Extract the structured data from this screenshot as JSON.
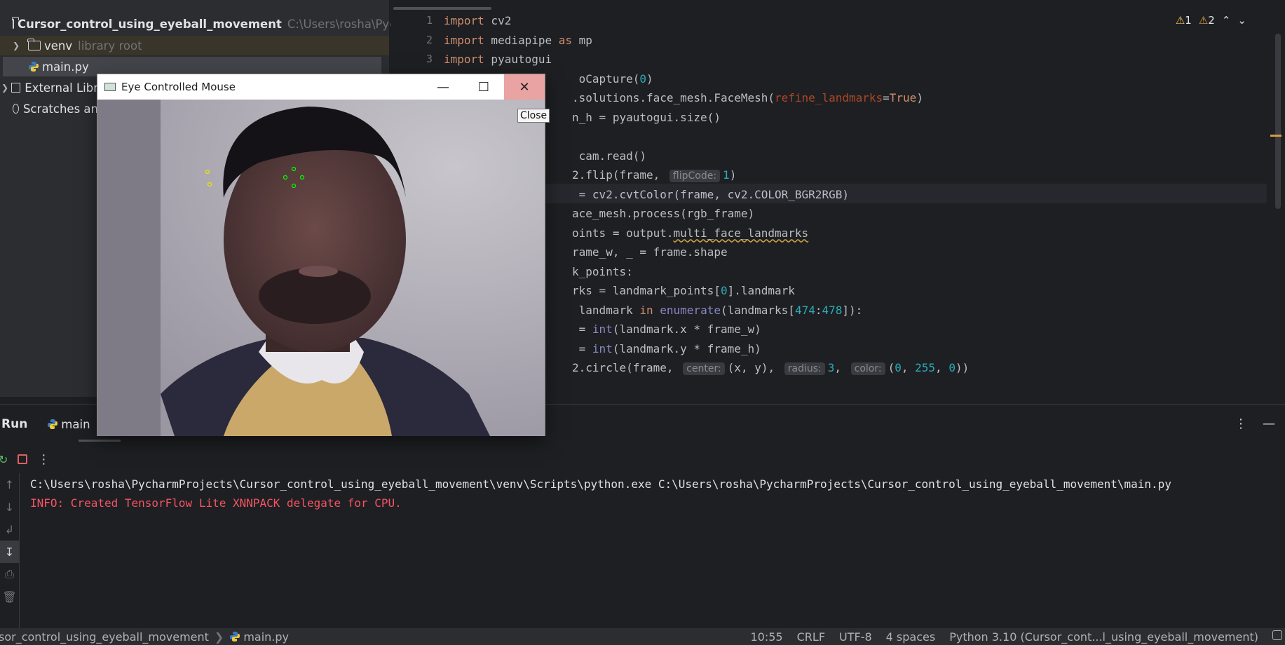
{
  "project": {
    "root_name": "Cursor_control_using_eyeball_movement",
    "root_path": "C:\\Users\\rosha\\Pych",
    "venv": "venv",
    "venv_note": "library root",
    "main_file": "main.py",
    "external": "External Libr",
    "scratches": "Scratches an"
  },
  "editor": {
    "line_numbers": [
      "1",
      "2",
      "3"
    ],
    "inspections": {
      "warnings_yellow": "1",
      "warnings_orange": "2"
    },
    "lines": [
      [
        {
          "t": "import",
          "c": "kw"
        },
        {
          "t": " cv2"
        }
      ],
      [
        {
          "t": "import",
          "c": "kw"
        },
        {
          "t": " mediapipe "
        },
        {
          "t": "as",
          "c": "kw"
        },
        {
          "t": " mp"
        }
      ],
      [
        {
          "t": "import",
          "c": "kw"
        },
        {
          "t": " pyautogui"
        }
      ],
      [
        {
          "t": "                    oCapture("
        },
        {
          "t": "0",
          "c": "num"
        },
        {
          "t": ")"
        }
      ],
      [
        {
          "t": "                   .solutions.face_mesh.FaceMesh("
        },
        {
          "t": "refine_landmarks",
          "c": "named"
        },
        {
          "t": "="
        },
        {
          "t": "True",
          "c": "kw"
        },
        {
          "t": ")"
        }
      ],
      [
        {
          "t": "                   n_h = pyautogui.size()"
        }
      ],
      [
        {
          "t": ""
        }
      ],
      [
        {
          "t": "                    cam.read()"
        }
      ],
      [
        {
          "t": "                   2.flip(frame, "
        },
        {
          "h": "flipCode:"
        },
        {
          "t": "1",
          "c": "num"
        },
        {
          "t": ")"
        }
      ],
      [
        {
          "t": "                    = cv2.cvtColor(frame, cv2.COLOR_BGR2RGB)"
        }
      ],
      [
        {
          "t": "                   ace_mesh.process(rgb_frame)"
        }
      ],
      [
        {
          "t": "                   oints = output."
        },
        {
          "t": "multi_face_landmarks",
          "c": "underline"
        }
      ],
      [
        {
          "t": "                   rame_w, _ = frame.shape"
        }
      ],
      [
        {
          "t": "                   k_points:"
        }
      ],
      [
        {
          "t": "                   rks = landmark_points["
        },
        {
          "t": "0",
          "c": "num"
        },
        {
          "t": "].landmark"
        }
      ],
      [
        {
          "t": "                    landmark "
        },
        {
          "t": "in",
          "c": "kw"
        },
        {
          "t": " "
        },
        {
          "t": "enumerate",
          "c": "builtin"
        },
        {
          "t": "(landmarks["
        },
        {
          "t": "474",
          "c": "num"
        },
        {
          "t": ":"
        },
        {
          "t": "478",
          "c": "num"
        },
        {
          "t": "]):"
        }
      ],
      [
        {
          "t": "                    = "
        },
        {
          "t": "int",
          "c": "builtin"
        },
        {
          "t": "(landmark.x * frame_w)"
        }
      ],
      [
        {
          "t": "                    = "
        },
        {
          "t": "int",
          "c": "builtin"
        },
        {
          "t": "(landmark.y * frame_h)"
        }
      ],
      [
        {
          "t": "                   2.circle(frame, "
        },
        {
          "h": "center:"
        },
        {
          "t": "(x, y), "
        },
        {
          "h": "radius:"
        },
        {
          "t": "3",
          "c": "num"
        },
        {
          "t": ", "
        },
        {
          "h": "color:"
        },
        {
          "t": "("
        },
        {
          "t": "0",
          "c": "num"
        },
        {
          "t": ", "
        },
        {
          "t": "255",
          "c": "num"
        },
        {
          "t": ", "
        },
        {
          "t": "0",
          "c": "num"
        },
        {
          "t": "))"
        }
      ]
    ]
  },
  "cv_window": {
    "title": "Eye Controlled Mouse",
    "tooltip": "Close",
    "markers_yellow": [
      [
        295,
        244
      ],
      [
        298,
        262
      ]
    ],
    "markers_green": [
      [
        418,
        240
      ],
      [
        406,
        252
      ],
      [
        430,
        252
      ],
      [
        418,
        264
      ]
    ]
  },
  "run": {
    "title": "Run",
    "tab": "main",
    "console": [
      {
        "text": "C:\\Users\\rosha\\PycharmProjects\\Cursor_control_using_eyeball_movement\\venv\\Scripts\\python.exe C:\\Users\\rosha\\PycharmProjects\\Cursor_control_using_eyeball_movement\\main.py",
        "err": false
      },
      {
        "text": "INFO: Created TensorFlow Lite XNNPACK delegate for CPU.",
        "err": true
      }
    ]
  },
  "status": {
    "breadcrumb_project": "sor_control_using_eyeball_movement",
    "breadcrumb_file": "main.py",
    "position": "10:55",
    "line_sep": "CRLF",
    "encoding": "UTF-8",
    "indent": "4 spaces",
    "interpreter": "Python 3.10 (Cursor_cont...l_using_eyeball_movement)"
  }
}
